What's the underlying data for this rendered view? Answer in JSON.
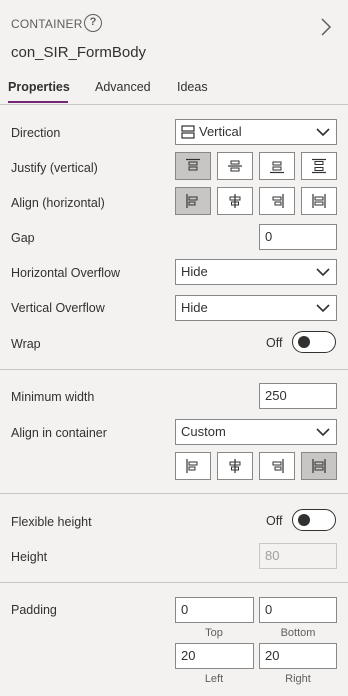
{
  "header": {
    "type_label": "CONTAINER",
    "help_glyph": "?",
    "control_name": "con_SIR_FormBody"
  },
  "tabs": [
    {
      "label": "Properties",
      "active": true
    },
    {
      "label": "Advanced",
      "active": false
    },
    {
      "label": "Ideas",
      "active": false
    }
  ],
  "layout": {
    "direction_label": "Direction",
    "direction_value": "Vertical",
    "justify_label": "Justify (vertical)",
    "align_label": "Align (horizontal)",
    "gap_label": "Gap",
    "gap_value": "0",
    "h_overflow_label": "Horizontal Overflow",
    "h_overflow_value": "Hide",
    "v_overflow_label": "Vertical Overflow",
    "v_overflow_value": "Hide",
    "wrap_label": "Wrap",
    "wrap_state": "Off"
  },
  "sizing": {
    "min_width_label": "Minimum width",
    "min_width_value": "250",
    "align_in_container_label": "Align in container",
    "align_in_container_value": "Custom"
  },
  "height": {
    "flexible_label": "Flexible height",
    "flexible_state": "Off",
    "height_label": "Height",
    "height_value": "80"
  },
  "padding": {
    "label": "Padding",
    "top_value": "0",
    "bottom_value": "0",
    "left_value": "20",
    "right_value": "20",
    "top_label": "Top",
    "bottom_label": "Bottom",
    "left_label": "Left",
    "right_label": "Right"
  },
  "colors": {
    "accent": "#742774",
    "selected": "#c8c6c4",
    "border": "#8a8886"
  }
}
